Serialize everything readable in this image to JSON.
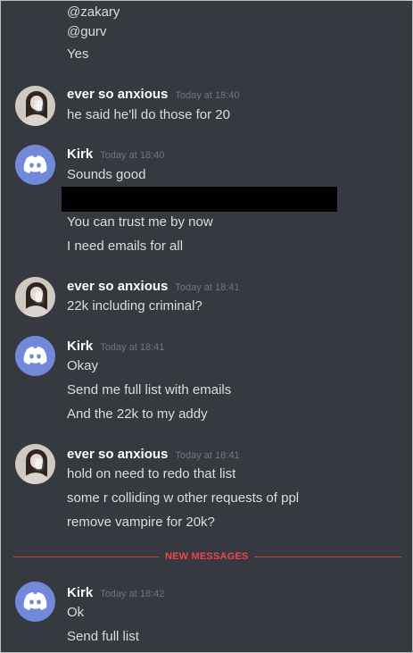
{
  "top_lines": [
    "@zakary",
    "@gurv",
    "Yes"
  ],
  "groups": [
    {
      "username": "ever so anxious",
      "timestamp": "Today at 18:40",
      "messages": [
        "he said he'll do those for 20"
      ]
    },
    {
      "username": "Kirk",
      "timestamp": "Today at 18:40",
      "messages": [
        "Sounds good",
        "You can trust me by now",
        "I need emails for all"
      ]
    },
    {
      "username": "ever so anxious",
      "timestamp": "Today at 18:41",
      "messages": [
        "22k including criminal?"
      ]
    },
    {
      "username": "Kirk",
      "timestamp": "Today at 18:41",
      "messages": [
        "Okay",
        "Send me full list with emails",
        "And the 22k to my addy"
      ]
    },
    {
      "username": "ever so anxious",
      "timestamp": "Today at 18:41",
      "messages": [
        "hold on need to redo that list",
        "some r colliding w other requests of ppl",
        "remove vampire for 20k?"
      ]
    },
    {
      "username": "Kirk",
      "timestamp": "Today at 18:42",
      "messages": [
        "Ok",
        "Send full list"
      ]
    }
  ],
  "divider_label": "NEW MESSAGES",
  "colors": {
    "background": "#36393f",
    "username": "#ffffff",
    "timestamp": "#72767d",
    "divider": "#f04747",
    "discord_blurple": "#7289da"
  },
  "icons": {
    "avatar_photo": "user-photo-avatar",
    "avatar_default": "discord-logo-icon"
  }
}
